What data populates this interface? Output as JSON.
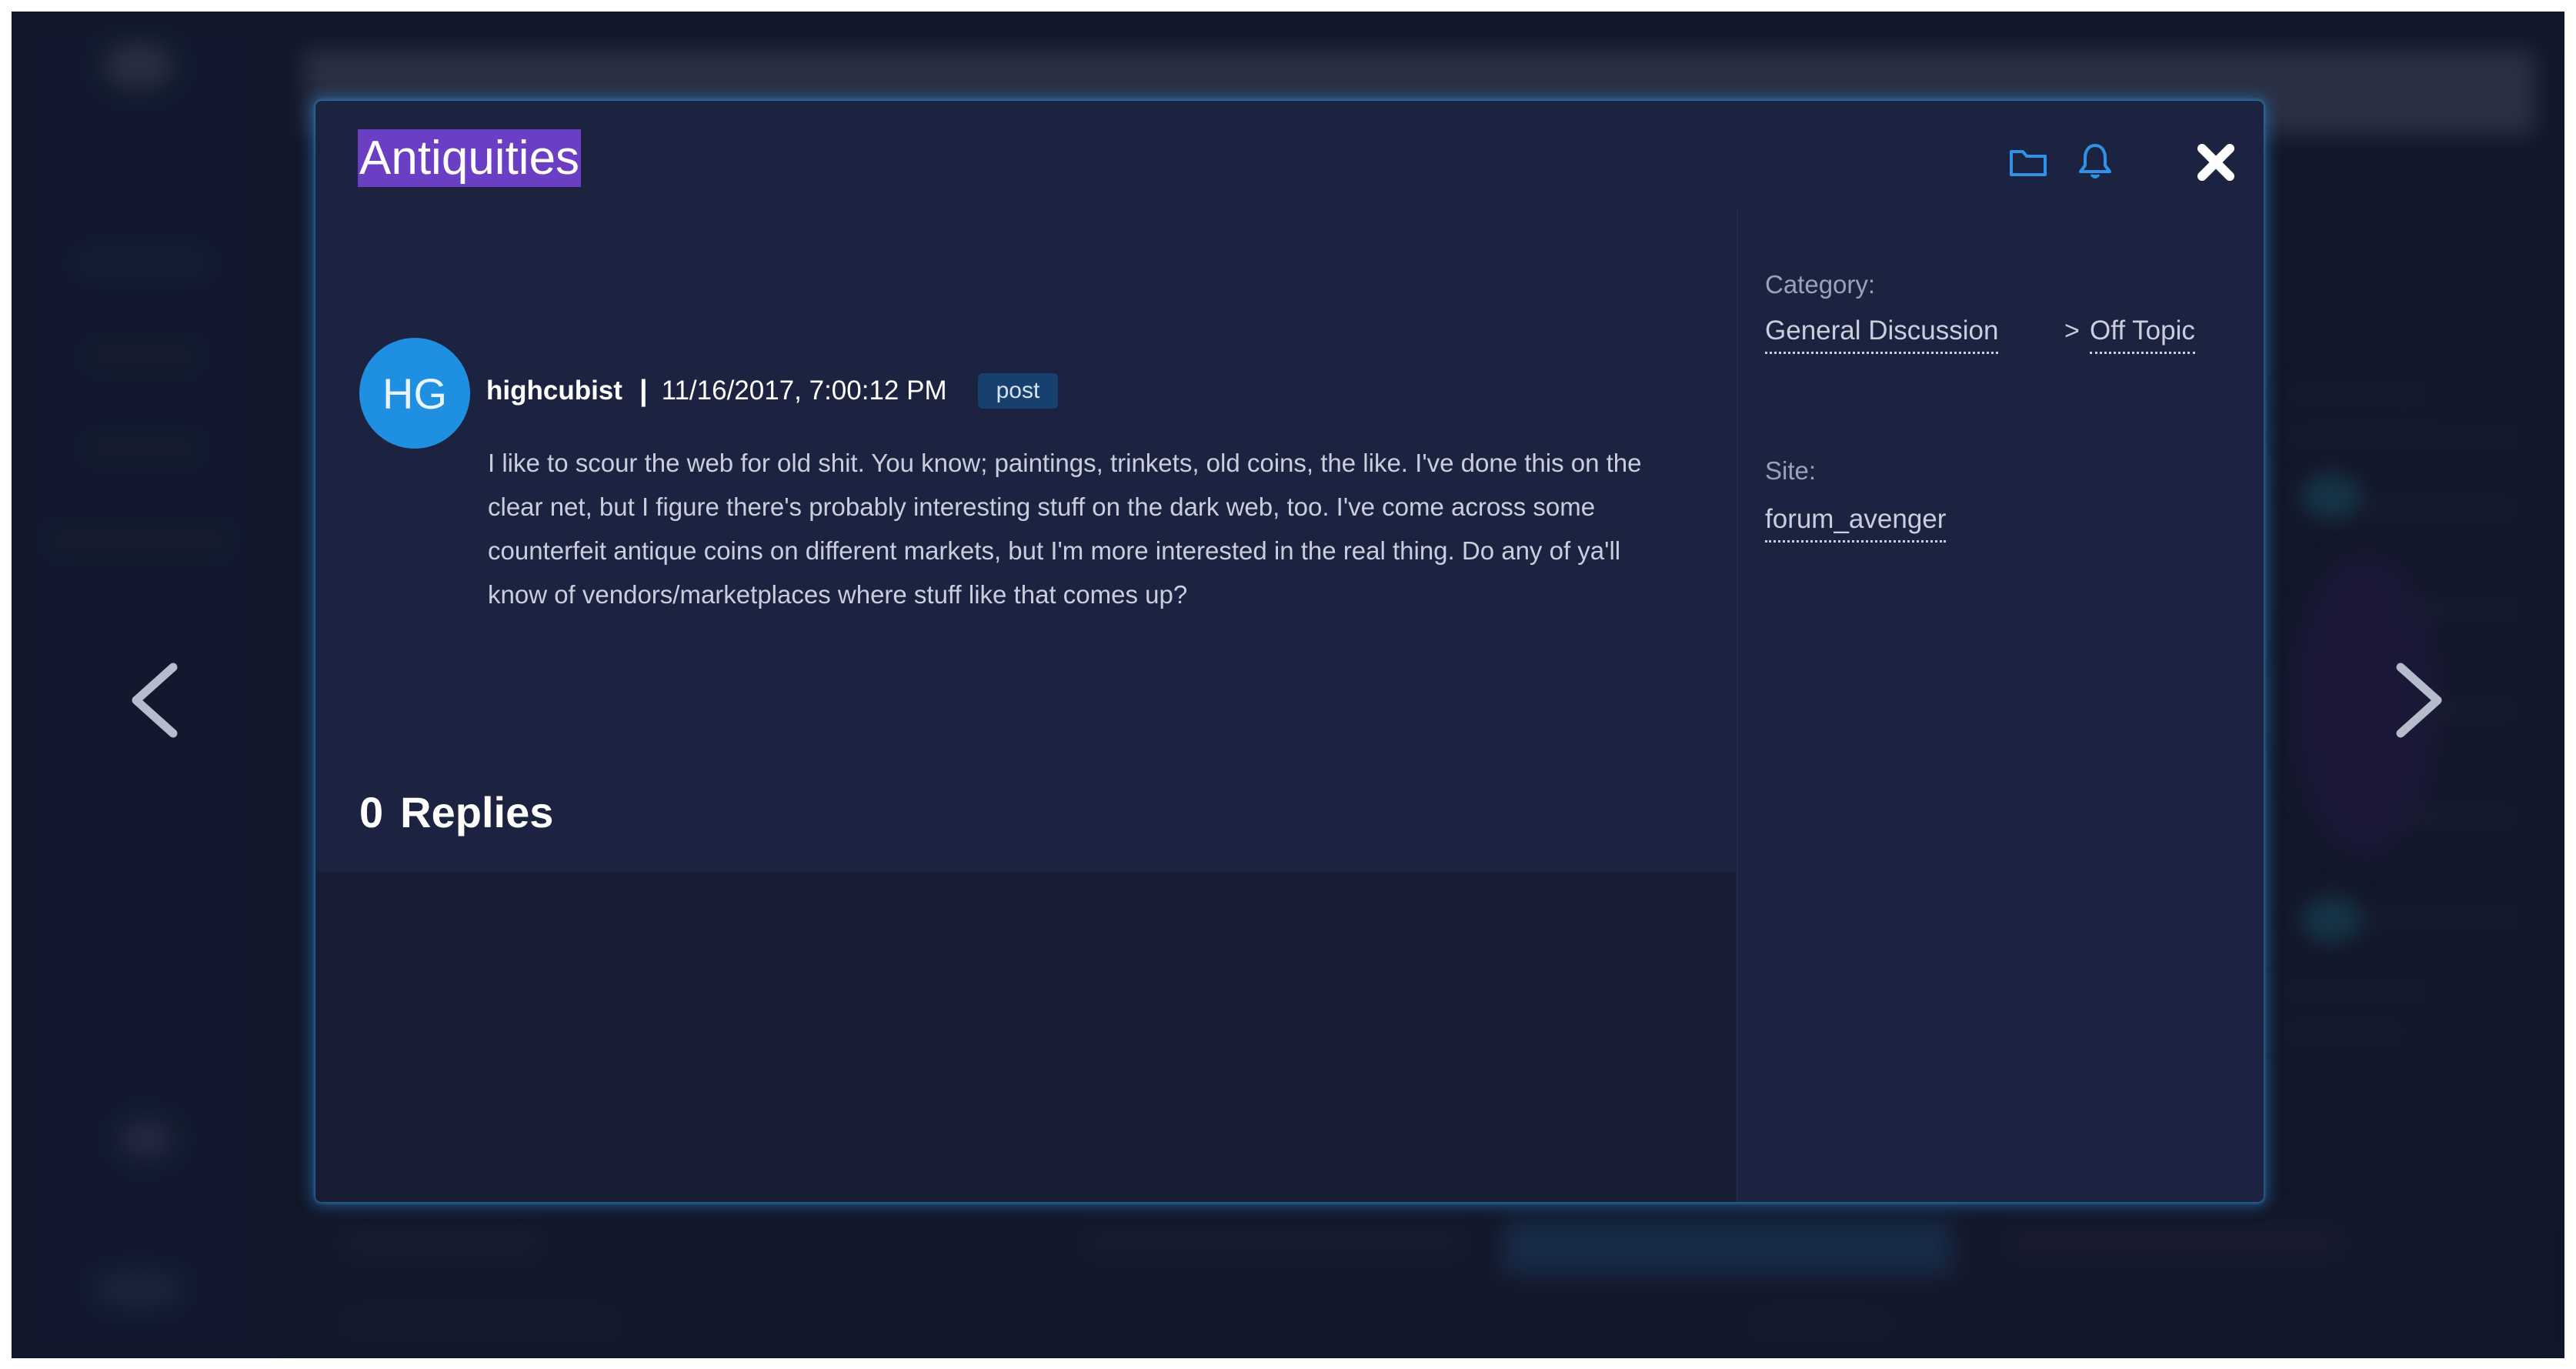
{
  "modal": {
    "title": "Antiquities",
    "title_highlight_color": "#6a3fc4",
    "icons": {
      "folder": "folder-icon",
      "bell": "bell-icon",
      "close": "close-icon"
    },
    "post": {
      "avatar_initials": "HG",
      "avatar_color": "#1f8fe2",
      "username": "highcubist",
      "separator": "|",
      "timestamp": "11/16/2017, 7:00:12 PM",
      "type_badge": "post",
      "body": "I like to scour the web for old shit. You know; paintings, trinkets, old coins, the like. I've done this on the clear net, but I figure there's probably interesting stuff on the dark web, too. I've come across some counterfeit antique coins on different markets, but I'm more interested in the real thing. Do any of ya'll know of vendors/marketplaces where stuff like that comes up?"
    },
    "replies": {
      "count": "0",
      "label": "Replies"
    },
    "sidebar": {
      "category_label": "Category:",
      "category_path": [
        "General Discussion",
        "Off Topic"
      ],
      "category_separator": ">",
      "site_label": "Site:",
      "site_value": "forum_avenger"
    }
  },
  "navigation": {
    "prev_icon": "chevron-left-icon",
    "next_icon": "chevron-right-icon"
  }
}
